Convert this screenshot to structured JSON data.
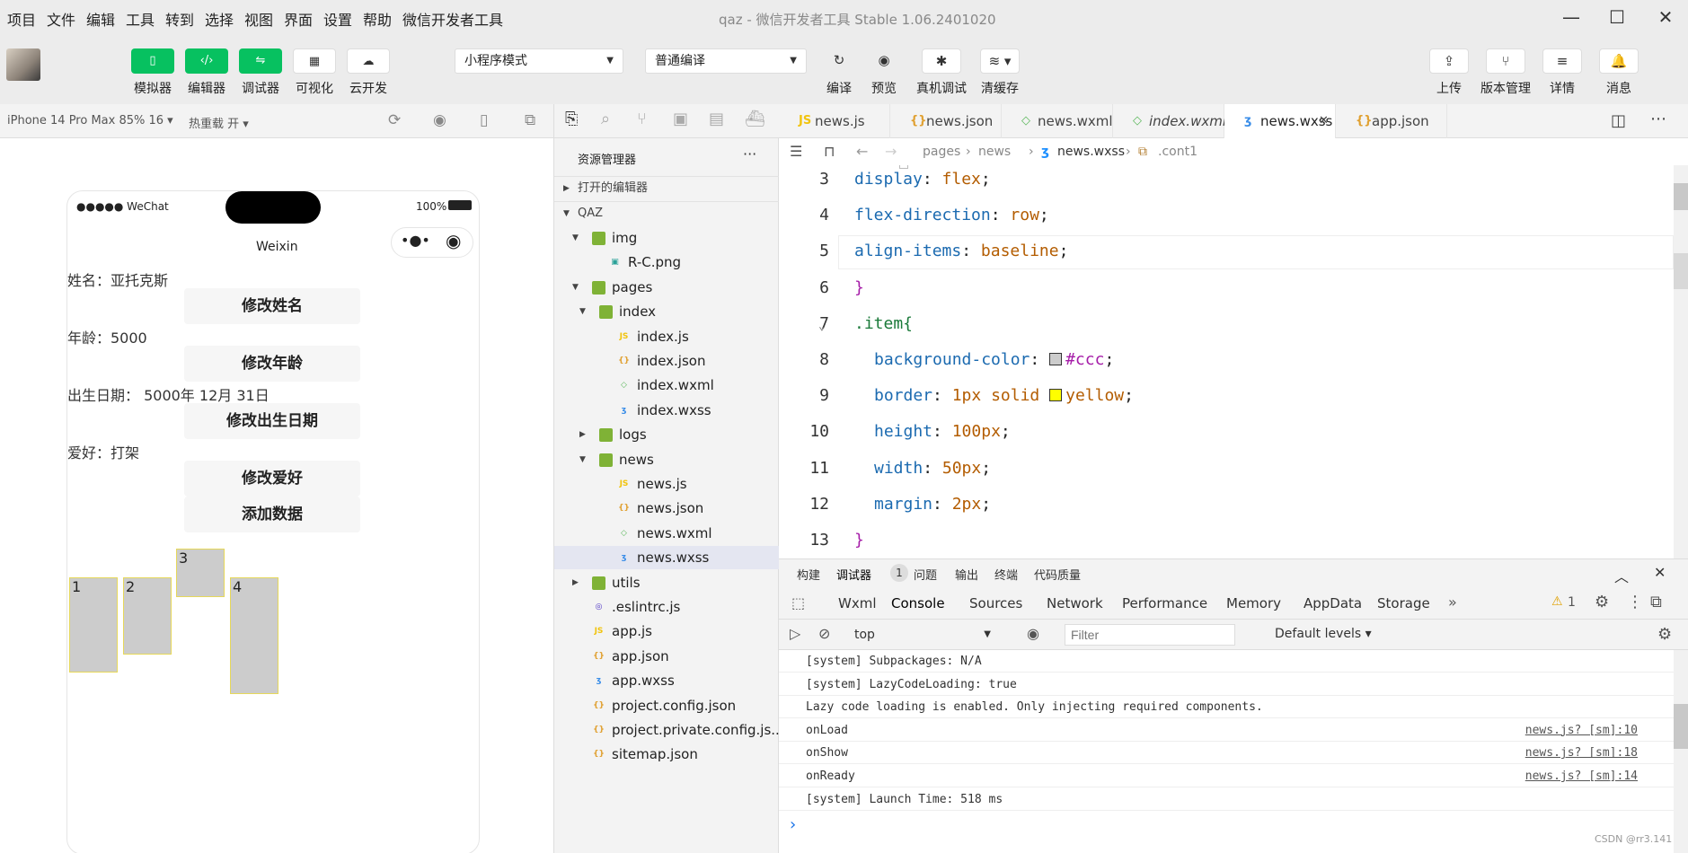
{
  "menu": [
    "项目",
    "文件",
    "编辑",
    "工具",
    "转到",
    "选择",
    "视图",
    "界面",
    "设置",
    "帮助",
    "微信开发者工具"
  ],
  "window_title": "qaz - 微信开发者工具 Stable 1.06.2401020",
  "toolbar": {
    "left_buttons": [
      {
        "label": "模拟器",
        "icon": "phone-icon"
      },
      {
        "label": "编辑器",
        "icon": "code-icon"
      },
      {
        "label": "调试器",
        "icon": "debug-icon"
      },
      {
        "label": "可视化",
        "icon": "layout-icon"
      },
      {
        "label": "云开发",
        "icon": "cloud-icon"
      }
    ],
    "mode_select": "小程序模式",
    "compile_select": "普通编译",
    "mid_buttons": [
      {
        "label": "编译",
        "icon": "refresh-icon"
      },
      {
        "label": "预览",
        "icon": "eye-icon"
      },
      {
        "label": "真机调试",
        "icon": "bug-icon"
      },
      {
        "label": "清缓存",
        "icon": "layers-icon"
      }
    ],
    "right_buttons": [
      {
        "label": "上传",
        "icon": "upload-icon"
      },
      {
        "label": "版本管理",
        "icon": "branch-icon"
      },
      {
        "label": "详情",
        "icon": "menu-icon"
      },
      {
        "label": "消息",
        "icon": "bell-icon"
      }
    ]
  },
  "simulator": {
    "device": "iPhone 14 Pro Max 85% 16",
    "hot_reload": "热重载 开",
    "status_left": "●●●●● WeChat",
    "status_right": "100%",
    "nav_title": "Weixin",
    "lines": [
      {
        "label": "姓名：亚托克斯"
      },
      {
        "label": "年龄：5000"
      },
      {
        "label": "出生日期： 5000年 12月 31日"
      },
      {
        "label": "爱好：打架"
      }
    ],
    "buttons": [
      "修改姓名",
      "修改年龄",
      "修改出生日期",
      "修改爱好",
      "添加数据"
    ],
    "boxes": [
      "1",
      "2",
      "3",
      "4"
    ]
  },
  "explorer": {
    "title": "资源管理器",
    "open_editors": "打开的编辑器",
    "project": "QAZ",
    "tree": [
      {
        "name": "img",
        "type": "folder",
        "depth": 1,
        "open": true
      },
      {
        "name": "R-C.png",
        "type": "image",
        "depth": 2
      },
      {
        "name": "pages",
        "type": "folder",
        "depth": 1,
        "open": true
      },
      {
        "name": "index",
        "type": "folder",
        "depth": 2,
        "open": true
      },
      {
        "name": "index.js",
        "type": "js",
        "depth": 3
      },
      {
        "name": "index.json",
        "type": "json",
        "depth": 3
      },
      {
        "name": "index.wxml",
        "type": "wxml",
        "depth": 3
      },
      {
        "name": "index.wxss",
        "type": "wxss",
        "depth": 3
      },
      {
        "name": "logs",
        "type": "folder",
        "depth": 2,
        "open": false
      },
      {
        "name": "news",
        "type": "folder",
        "depth": 2,
        "open": true
      },
      {
        "name": "news.js",
        "type": "js",
        "depth": 3
      },
      {
        "name": "news.json",
        "type": "json",
        "depth": 3
      },
      {
        "name": "news.wxml",
        "type": "wxml",
        "depth": 3
      },
      {
        "name": "news.wxss",
        "type": "wxss",
        "depth": 3,
        "selected": true
      },
      {
        "name": "utils",
        "type": "folder",
        "depth": 1,
        "open": false
      },
      {
        "name": ".eslintrc.js",
        "type": "eslint",
        "depth": 1
      },
      {
        "name": "app.js",
        "type": "js",
        "depth": 1
      },
      {
        "name": "app.json",
        "type": "json",
        "depth": 1
      },
      {
        "name": "app.wxss",
        "type": "wxss",
        "depth": 1
      },
      {
        "name": "project.config.json",
        "type": "json",
        "depth": 1
      },
      {
        "name": "project.private.config.js...",
        "type": "json",
        "depth": 1
      },
      {
        "name": "sitemap.json",
        "type": "json",
        "depth": 1
      }
    ]
  },
  "editor": {
    "tabs": [
      {
        "name": "news.js",
        "type": "js"
      },
      {
        "name": "news.json",
        "type": "json"
      },
      {
        "name": "news.wxml",
        "type": "wxml"
      },
      {
        "name": "index.wxml",
        "type": "wxml",
        "italic": true
      },
      {
        "name": "news.wxss",
        "type": "wxss",
        "active": true
      },
      {
        "name": "app.json",
        "type": "json"
      }
    ],
    "breadcrumb": [
      "pages",
      "news",
      "news.wxss",
      ".cont1"
    ],
    "lines": [
      {
        "n": "3",
        "prop": "display",
        "val": "flex"
      },
      {
        "n": "4",
        "prop": "flex-direction",
        "val": "row"
      },
      {
        "n": "5",
        "prop": "align-items",
        "val": "baseline"
      },
      {
        "n": "6",
        "text": "}"
      },
      {
        "n": "7",
        "text": ".item{"
      },
      {
        "n": "8",
        "prop": "background-color",
        "val": "#ccc",
        "swatch": "#cccccc"
      },
      {
        "n": "9",
        "prop": "border",
        "val": "1px solid",
        "val2": "yellow",
        "swatch": "#ffff00"
      },
      {
        "n": "10",
        "prop": "height",
        "val": "100px"
      },
      {
        "n": "11",
        "prop": "width",
        "val": "50px"
      },
      {
        "n": "12",
        "prop": "margin",
        "val": "2px"
      },
      {
        "n": "13",
        "text": "}"
      }
    ]
  },
  "devtools": {
    "head_tabs": [
      "构建",
      "调试器",
      "问题",
      "输出",
      "终端",
      "代码质量"
    ],
    "debugger_badge": "1",
    "tabs": [
      "Wxml",
      "Console",
      "Sources",
      "Network",
      "Performance",
      "Memory",
      "AppData",
      "Storage"
    ],
    "active_tab": "Console",
    "warn_count": "1",
    "context": "top",
    "filter_placeholder": "Filter",
    "levels": "Default levels",
    "logs": [
      {
        "msg": "[system] Subpackages: N/A",
        "link": ""
      },
      {
        "msg": "[system] LazyCodeLoading: true",
        "link": ""
      },
      {
        "msg": "Lazy code loading is enabled. Only injecting required components.",
        "link": ""
      },
      {
        "msg": "onLoad",
        "link": "news.js? [sm]:10"
      },
      {
        "msg": "onShow",
        "link": "news.js? [sm]:18"
      },
      {
        "msg": "onReady",
        "link": "news.js? [sm]:14"
      },
      {
        "msg": "[system] Launch Time: 518 ms",
        "link": ""
      }
    ],
    "prompt": "›"
  },
  "watermark": "CSDN @rr3.141",
  "colors": {
    "green": "#07c160",
    "accent": "#1b6ab0"
  }
}
